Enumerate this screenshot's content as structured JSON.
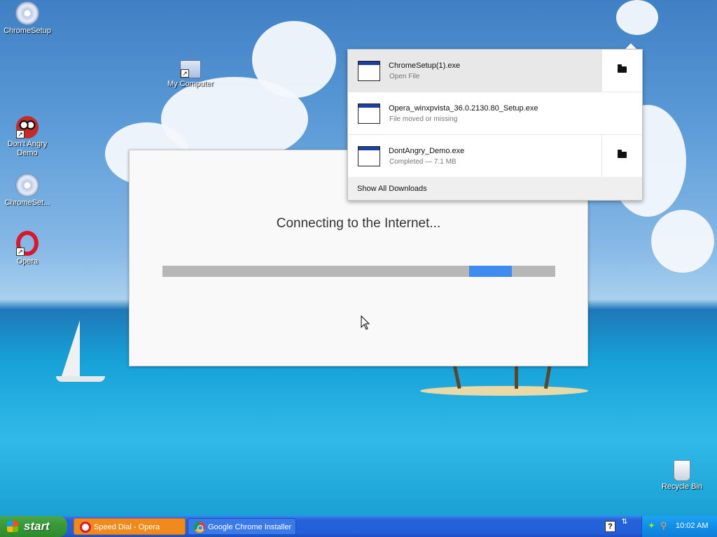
{
  "desktop": {
    "icons": [
      {
        "label": "ChromeSetup"
      },
      {
        "label": "My Computer"
      },
      {
        "label": "Don't Angry Demo"
      },
      {
        "label": "ChromeSet..."
      },
      {
        "label": "Opera"
      },
      {
        "label": "Recycle Bin"
      }
    ]
  },
  "installer": {
    "message": "Connecting to the Internet...",
    "progress_fraction": 0.89
  },
  "downloads": {
    "items": [
      {
        "name": "ChromeSetup(1).exe",
        "status": "Open File",
        "has_folder": true
      },
      {
        "name": "Opera_winxpvista_36.0.2130.80_Setup.exe",
        "status": "File moved or missing",
        "has_folder": false
      },
      {
        "name": "DontAngry_Demo.exe",
        "status": "Completed — 7.1 MB",
        "has_folder": true
      }
    ],
    "show_all_label": "Show All Downloads"
  },
  "taskbar": {
    "start_label": "start",
    "tasks": [
      {
        "label": "Speed Dial - Opera",
        "icon": "opera-icon"
      },
      {
        "label": "Google Chrome Installer",
        "icon": "chrome-icon"
      }
    ],
    "help_glyph": "?",
    "clock": "10:02 AM"
  }
}
